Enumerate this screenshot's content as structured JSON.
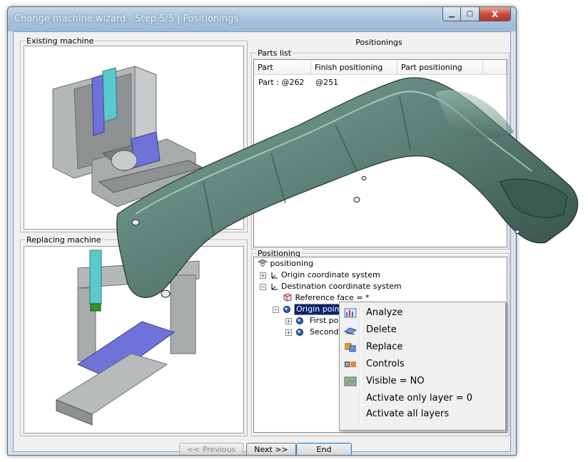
{
  "window": {
    "title": "Change machine wizard - Step 5/5 | Positionings",
    "minimize_label": "▁",
    "maximize_label": "□",
    "close_label": "X"
  },
  "existing_machine": {
    "label": "Existing machine"
  },
  "replacing_machine": {
    "label": "Replacing machine"
  },
  "positionings": {
    "heading": "Positionings",
    "parts_list": {
      "label": "Parts list",
      "columns": [
        "Part",
        "Finish positioning",
        "Part positioning"
      ],
      "rows": [
        {
          "part": "Part : @262",
          "finish": "@251",
          "part_pos": ""
        }
      ]
    },
    "positioning": {
      "label": "Positioning",
      "tree": {
        "root": "positioning",
        "origin_cs": "Origin coordinate system",
        "destination_cs": "Destination coordinate system",
        "reference_face": "Reference face = *",
        "origin_point": "Origin point",
        "first_point": "First poin",
        "second_point": "Second p"
      }
    }
  },
  "context_menu": {
    "items": [
      {
        "label": "Analyze",
        "icon": "analyze-icon"
      },
      {
        "label": "Delete",
        "icon": "delete-icon"
      },
      {
        "label": "Replace",
        "icon": "replace-icon"
      },
      {
        "label": "Controls",
        "icon": "controls-icon"
      },
      {
        "label": "Visible = NO",
        "icon": "visibility-icon"
      },
      {
        "label": "Activate only layer = 0",
        "icon": ""
      },
      {
        "label": "Activate all layers",
        "icon": ""
      }
    ]
  },
  "buttons": {
    "previous": "<< Previous",
    "next": "Next >>",
    "end": "End"
  },
  "colors": {
    "selection": "#0a246a",
    "part_render": "#5a7d74",
    "machine_gray": "#a8acad",
    "machine_blue": "#6f72d8",
    "machine_cyan": "#5cc9cf"
  }
}
